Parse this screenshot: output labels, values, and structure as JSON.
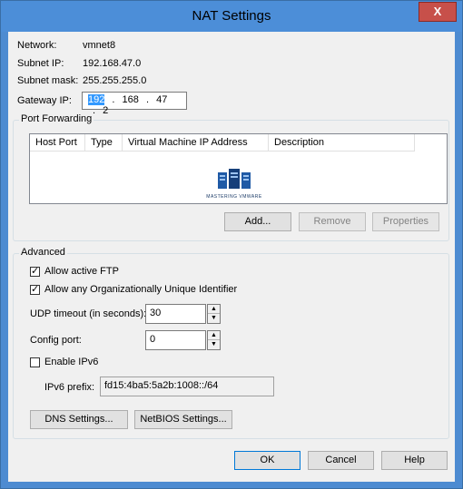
{
  "window": {
    "title": "NAT Settings",
    "close_glyph": "X"
  },
  "info": {
    "network_label": "Network:",
    "network_value": "vmnet8",
    "subnet_ip_label": "Subnet IP:",
    "subnet_ip_value": "192.168.47.0",
    "subnet_mask_label": "Subnet mask:",
    "subnet_mask_value": "255.255.255.0",
    "gateway_label": "Gateway IP:",
    "gateway_octets": [
      "192",
      "168",
      "47",
      "2"
    ]
  },
  "port_forwarding": {
    "title": "Port Forwarding",
    "columns": [
      "Host Port",
      "Type",
      "Virtual Machine IP Address",
      "Description"
    ],
    "logo_text": "MASTERING VMWARE",
    "add_label": "Add...",
    "remove_label": "Remove",
    "properties_label": "Properties"
  },
  "advanced": {
    "title": "Advanced",
    "allow_ftp_label": "Allow active FTP",
    "allow_ftp_checked": true,
    "allow_oui_label": "Allow any Organizationally Unique Identifier",
    "allow_oui_checked": true,
    "udp_timeout_label": "UDP timeout (in seconds):",
    "udp_timeout_value": "30",
    "config_port_label": "Config port:",
    "config_port_value": "0",
    "enable_ipv6_label": "Enable IPv6",
    "enable_ipv6_checked": false,
    "ipv6_prefix_label": "IPv6 prefix:",
    "ipv6_prefix_value": "fd15:4ba5:5a2b:1008::/64",
    "dns_settings_label": "DNS Settings...",
    "netbios_settings_label": "NetBIOS Settings..."
  },
  "footer": {
    "ok_label": "OK",
    "cancel_label": "Cancel",
    "help_label": "Help"
  },
  "colors": {
    "titlebar": "#4c8ed8",
    "close_button": "#c7504a",
    "dialog_bg": "#f0f0f0",
    "selection": "#3399ff"
  }
}
